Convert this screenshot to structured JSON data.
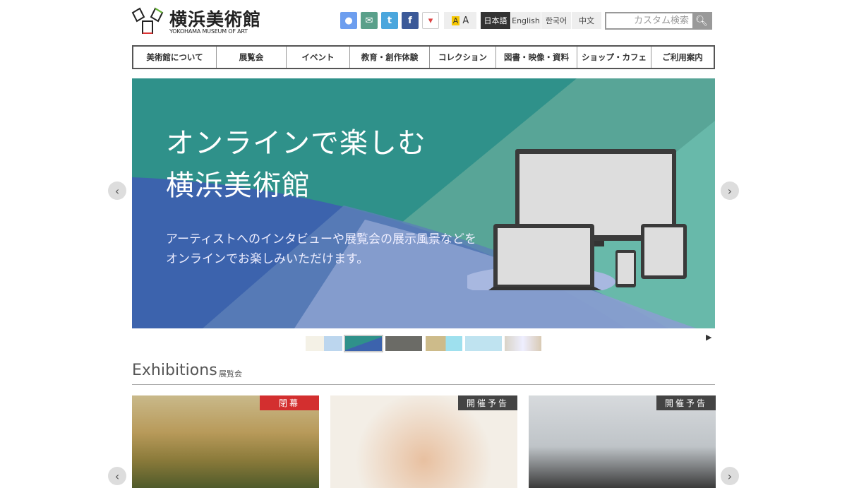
{
  "header": {
    "logo_title": "横浜美術館",
    "logo_subtitle": "YOKOHAMA MUSEUM OF ART",
    "social": [
      {
        "icon": "chat-icon",
        "color": "#6d9eef"
      },
      {
        "icon": "mail-icon",
        "color": "#5aa08a"
      },
      {
        "icon": "twitter-icon",
        "color": "#4aa6dd"
      },
      {
        "icon": "facebook-icon",
        "color": "#3b5998"
      },
      {
        "icon": "trivago-icon",
        "color": "#ffffff"
      }
    ],
    "font_size": {
      "small": "A",
      "large": "A"
    },
    "languages": [
      {
        "label": "日本語",
        "active": true
      },
      {
        "label": "English"
      },
      {
        "label": "한국어"
      },
      {
        "label": "中文"
      }
    ],
    "search": {
      "placeholder": "カスタム検索"
    }
  },
  "nav": [
    "美術館について",
    "展覧会",
    "イベント",
    "教育・創作体験",
    "コレクション",
    "図書・映像・資料",
    "ショップ・カフェ",
    "ご利用案内"
  ],
  "banner": {
    "title_line1": "オンラインで楽しむ",
    "title_line2": "横浜美術館",
    "desc_line1": "アーティストへのインタビューや展覧会の展示風景などを",
    "desc_line2": "オンラインでお楽しみいただけます。",
    "prev": "‹",
    "next": "›",
    "play": "▶"
  },
  "exhibitions": {
    "title": "Exhibitions",
    "subtitle": "展覧会",
    "cards": [
      {
        "badge": "閉幕",
        "badge_color": "#d32f2f"
      },
      {
        "badge": "開催予告",
        "badge_color": "#444444"
      },
      {
        "badge": "開催予告",
        "badge_color": "#444444"
      }
    ],
    "prev": "‹",
    "next": "›"
  }
}
